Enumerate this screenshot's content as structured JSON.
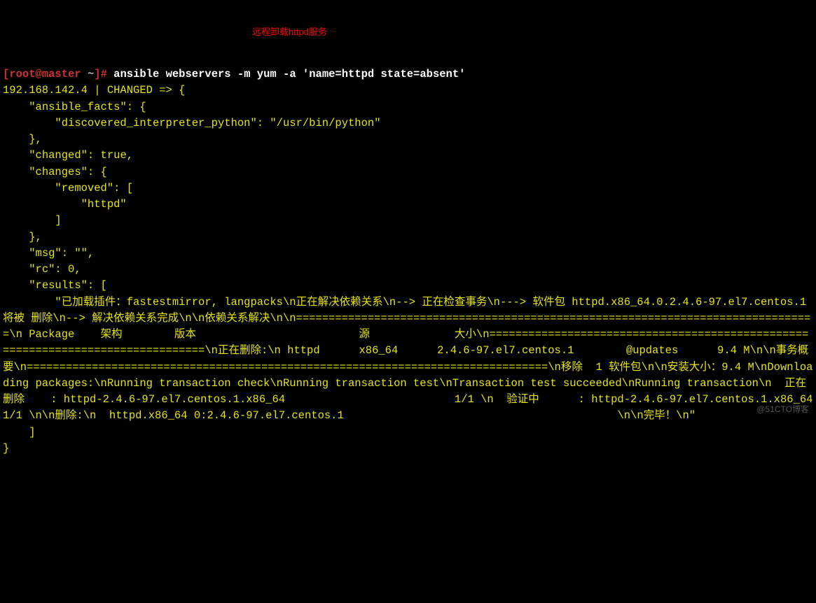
{
  "prompt": {
    "bracket_open": "[",
    "user_host": "root@master",
    "tilde": " ~",
    "bracket_close": "]",
    "hash": "# ",
    "command": "ansible webservers -m yum -a 'name=httpd state=absent'"
  },
  "annotation": "远程卸载httpd服务",
  "output": {
    "line1": "192.168.142.4 | CHANGED => {",
    "line2": "    \"ansible_facts\": {",
    "line3": "        \"discovered_interpreter_python\": \"/usr/bin/python\"",
    "line4": "    },",
    "line5": "    \"changed\": true,",
    "line6": "    \"changes\": {",
    "line7": "        \"removed\": [",
    "line8": "            \"httpd\"",
    "line9": "        ]",
    "line10": "    },",
    "line11": "    \"msg\": \"\",",
    "line12": "    \"rc\": 0,",
    "line13": "    \"results\": [",
    "line14": "        \"已加载插件：fastestmirror, langpacks\\n正在解决依赖关系\\n--> 正在检查事务\\n---> 软件包 httpd.x86_64.0.2.4.6-97.el7.centos.1 将被 删除\\n--> 解决依赖关系完成\\n\\n依赖关系解决\\n\\n================================================================================\\n Package    架构        版本                         源             大小\\n================================================================================\\n正在删除:\\n httpd      x86_64      2.4.6-97.el7.centos.1        @updates      9.4 M\\n\\n事务概要\\n================================================================================\\n移除  1 软件包\\n\\n安装大小：9.4 M\\nDownloading packages:\\nRunning transaction check\\nRunning transaction test\\nTransaction test succeeded\\nRunning transaction\\n  正在删除    : httpd-2.4.6-97.el7.centos.1.x86_64                          1/1 \\n  验证中      : httpd-2.4.6-97.el7.centos.1.x86_64                          1/1 \\n\\n删除:\\n  httpd.x86_64 0:2.4.6-97.el7.centos.1                                          \\n\\n完毕！\\n\"",
    "line15": "    ]",
    "line16": "}"
  },
  "watermark": "@51CTO博客"
}
